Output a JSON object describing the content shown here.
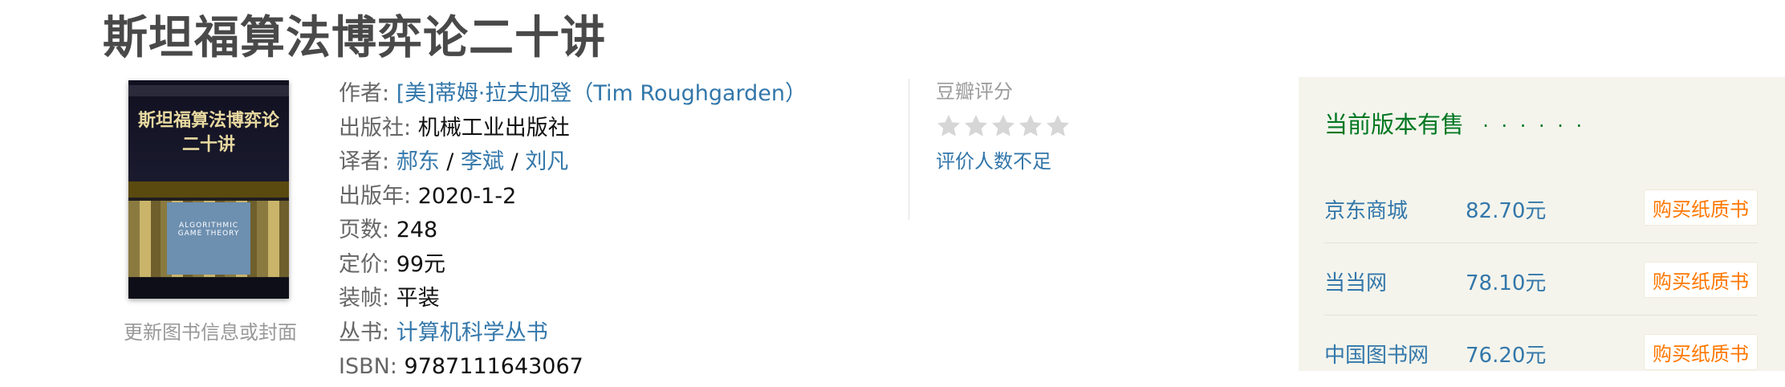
{
  "book": {
    "title": "斯坦福算法博弈论二十讲",
    "cover_title": "斯坦福算法博弈论二十讲",
    "cover_english": "ALGORITHMIC GAME THEORY",
    "update_link": "更新图书信息或封面"
  },
  "info": {
    "author_label": "作者:",
    "author": "[美]蒂姆·拉夫加登（Tim Roughgarden）",
    "publisher_label": "出版社:",
    "publisher": "机械工业出版社",
    "translator_label": "译者:",
    "translators": [
      "郝东",
      "李斌",
      "刘凡"
    ],
    "separator": "/",
    "year_label": "出版年:",
    "year": "2020-1-2",
    "pages_label": "页数:",
    "pages": "248",
    "price_label": "定价:",
    "price": "99元",
    "binding_label": "装帧:",
    "binding": "平装",
    "series_label": "丛书:",
    "series": "计算机科学丛书",
    "isbn_label": "ISBN:",
    "isbn": "9787111643067"
  },
  "rating": {
    "title": "豆瓣评分",
    "stars_filled": 0,
    "stars_total": 5,
    "star_color": "#d6d6d6",
    "insufficient": "评价人数不足"
  },
  "buy": {
    "title": "当前版本有售",
    "dots": "· · · · · ·",
    "stores": [
      {
        "name": "京东商城",
        "price": "82.70元",
        "button": "购买纸质书"
      },
      {
        "name": "当当网",
        "price": "78.10元",
        "button": "购买纸质书"
      },
      {
        "name": "中国图书网",
        "price": "76.20元",
        "button": "购买纸质书"
      }
    ]
  }
}
